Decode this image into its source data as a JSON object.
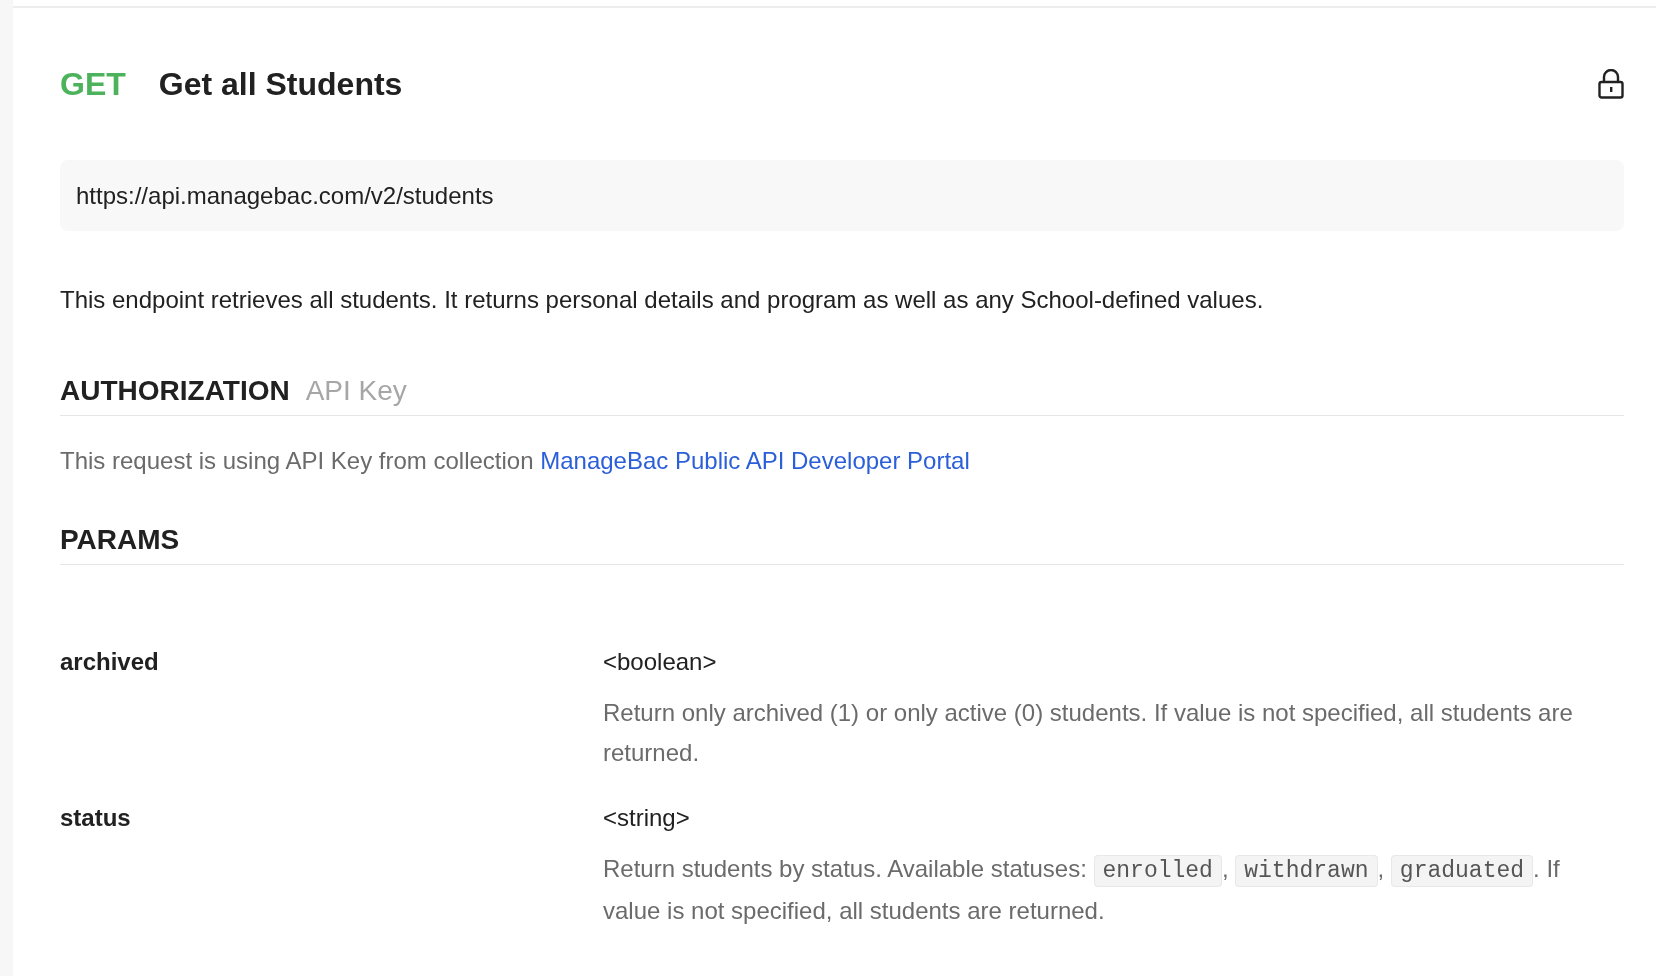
{
  "request": {
    "method": "GET",
    "title": "Get all Students",
    "url": "https://api.managebac.com/v2/students",
    "locked": true
  },
  "description": "This endpoint retrieves all students. It returns personal details and program as well as any School-defined values.",
  "authorization": {
    "heading": "AUTHORIZATION",
    "type": "API Key",
    "text": "This request is using API Key from collection",
    "link": "ManageBac Public API Developer Portal"
  },
  "params": {
    "heading": "PARAMS",
    "items": [
      {
        "name": "archived",
        "type": "<boolean>",
        "description": [
          {
            "kind": "text",
            "text": "Return only archived (1) or only active (0) students. If value is not specified, all students are returned."
          }
        ]
      },
      {
        "name": "status",
        "type": "<string>",
        "description": [
          {
            "kind": "text",
            "text": "Return students by status. Available statuses: "
          },
          {
            "kind": "code",
            "text": "enrolled"
          },
          {
            "kind": "text",
            "text": ", "
          },
          {
            "kind": "code",
            "text": "withdrawn"
          },
          {
            "kind": "text",
            "text": ", "
          },
          {
            "kind": "code",
            "text": "graduated"
          },
          {
            "kind": "text",
            "text": ". If value is not specified, all students are returned."
          }
        ]
      }
    ]
  }
}
